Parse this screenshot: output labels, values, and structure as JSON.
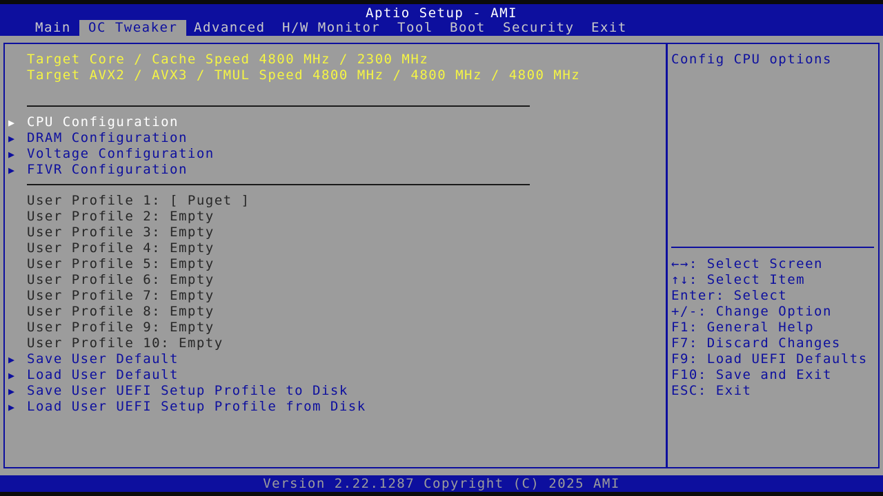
{
  "header": {
    "title": "Aptio Setup - AMI",
    "tabs": [
      "Main",
      "OC Tweaker",
      "Advanced",
      "H/W Monitor",
      "Tool",
      "Boot",
      "Security",
      "Exit"
    ],
    "active_tab": "OC Tweaker"
  },
  "info": {
    "target_core": "Target Core / Cache Speed 4800 MHz / 2300 MHz",
    "target_avx": "Target AVX2 / AVX3 / TMUL Speed 4800 MHz / 4800 MHz / 4800 MHz"
  },
  "menu": {
    "config_items": [
      "CPU Configuration",
      "DRAM Configuration",
      "Voltage Configuration",
      "FIVR Configuration"
    ],
    "profiles": [
      "User Profile 1: [ Puget ]",
      "User Profile 2: Empty",
      "User Profile 3: Empty",
      "User Profile 4: Empty",
      "User Profile 5: Empty",
      "User Profile 6: Empty",
      "User Profile 7: Empty",
      "User Profile 8: Empty",
      "User Profile 9: Empty",
      "User Profile 10: Empty"
    ],
    "actions": [
      "Save User Default",
      "Load User Default",
      "Save User UEFI Setup Profile to Disk",
      "Load User UEFI Setup Profile from Disk"
    ],
    "selected": "CPU Configuration"
  },
  "help": {
    "description": "Config CPU options",
    "keys": [
      "←→: Select Screen",
      "↑↓: Select Item",
      "Enter: Select",
      "+/-: Change Option",
      "F1: General Help",
      "F7: Discard Changes",
      "F9: Load UEFI Defaults",
      "F10: Save and Exit",
      "ESC: Exit"
    ]
  },
  "footer": {
    "version": "Version 2.22.1287 Copyright (C) 2025 AMI"
  },
  "colors": {
    "bar_blue": "#0d0f9e",
    "panel_gray": "#9c9c9c",
    "info_yellow": "#f5f544",
    "selected_white": "#ffffff"
  },
  "icons": {
    "submenu_arrow": "right-triangle-icon"
  }
}
